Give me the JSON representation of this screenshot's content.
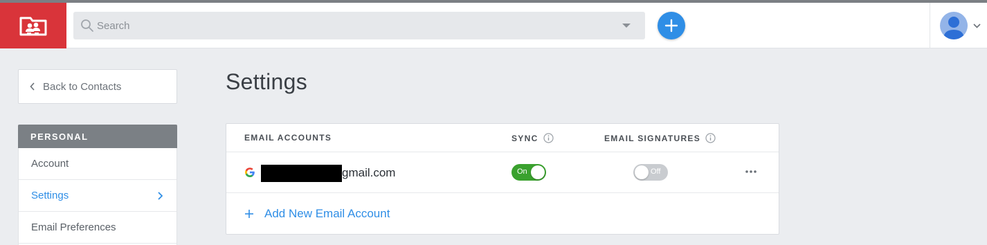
{
  "header": {
    "search": {
      "placeholder": "Search",
      "value": ""
    },
    "add_button_icon": "plus-icon",
    "logo_icon": "contacts-logo-icon",
    "avatar_icon": "user-avatar-icon"
  },
  "sidebar": {
    "back_label": "Back to Contacts",
    "section_title": "PERSONAL",
    "items": [
      {
        "label": "Account",
        "active": false
      },
      {
        "label": "Settings",
        "active": true
      },
      {
        "label": "Email Preferences",
        "active": false
      }
    ]
  },
  "main": {
    "title": "Settings",
    "table": {
      "columns": [
        "EMAIL ACCOUNTS",
        "SYNC",
        "EMAIL SIGNATURES"
      ],
      "rows": [
        {
          "provider_icon": "google-icon",
          "email_visible": "gmail.com",
          "sync": "On",
          "signatures": "Off"
        }
      ],
      "add_label": "Add New Email Account"
    }
  },
  "colors": {
    "brand_red": "#d9343a",
    "accent_blue": "#2f8ee6",
    "toggle_on": "#3aa12e",
    "toggle_off": "#c9ccd0",
    "sidebar_header": "#7b8085"
  }
}
